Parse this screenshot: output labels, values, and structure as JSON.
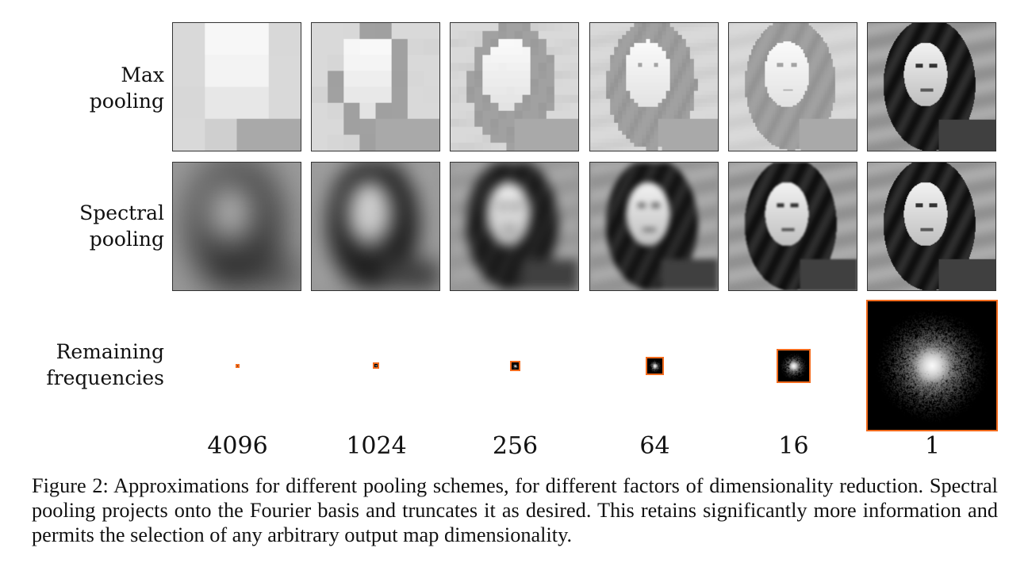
{
  "rows": [
    {
      "label_line1": "Max",
      "label_line2": "pooling"
    },
    {
      "label_line1": "Spectral",
      "label_line2": "pooling"
    },
    {
      "label_line1": "Remaining",
      "label_line2": "frequencies"
    }
  ],
  "factors": [
    "4096",
    "1024",
    "256",
    "64",
    "16",
    "1"
  ],
  "frequency_box_color": "#f26b1d",
  "caption": "Figure 2:  Approximations for different pooling schemes, for different factors of dimensionality reduction. Spectral pooling projects onto the Fourier basis and truncates it as desired. This retains significantly more information and permits the selection of any arbitrary output map dimensionality."
}
